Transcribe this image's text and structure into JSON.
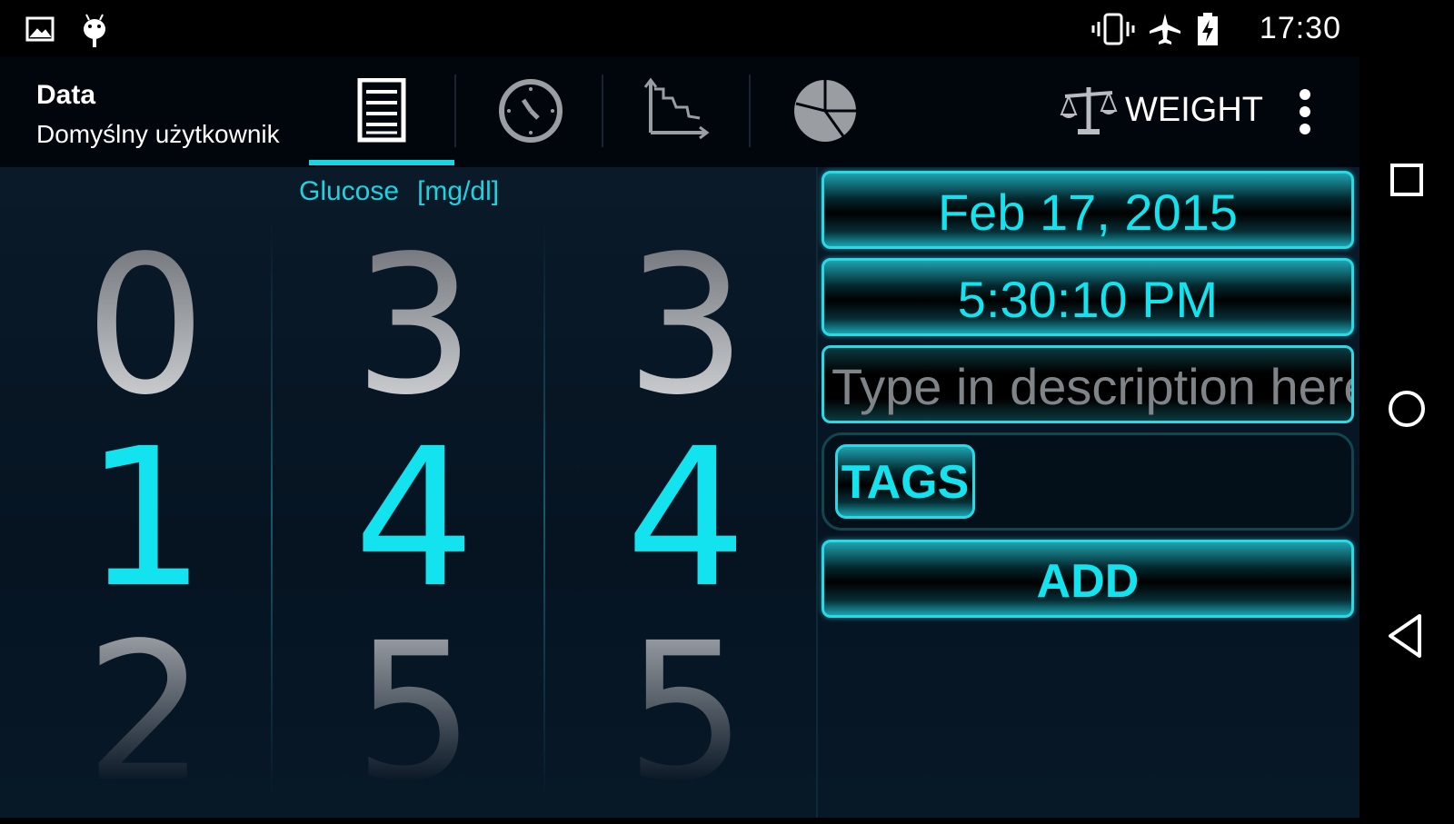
{
  "status_bar": {
    "time": "17:30",
    "icons": [
      "image-notification-icon",
      "android-debug-icon",
      "vibrate-icon",
      "airplane-mode-icon",
      "battery-charging-icon"
    ]
  },
  "action_bar": {
    "title": "Data",
    "subtitle": "Domyślny użytkownik",
    "tabs": [
      {
        "icon": "list-icon",
        "selected": true
      },
      {
        "icon": "clock-icon",
        "selected": false
      },
      {
        "icon": "trend-chart-icon",
        "selected": false
      },
      {
        "icon": "pie-chart-icon",
        "selected": false
      }
    ],
    "weight_label": "WEIGHT",
    "weight_icon": "scale-icon",
    "accent_color": "#17d7e4"
  },
  "picker": {
    "label": "Glucose",
    "unit": "[mg/dl]",
    "columns": [
      {
        "prev": "0",
        "current": "1",
        "next": "2"
      },
      {
        "prev": "3",
        "current": "4",
        "next": "5"
      },
      {
        "prev": "3",
        "current": "4",
        "next": "5"
      }
    ]
  },
  "form": {
    "date": "Feb 17, 2015",
    "time": "5:30:10 PM",
    "description_placeholder": "Type in description here",
    "tags_label": "TAGS",
    "add_label": "ADD"
  },
  "nav_bar": {
    "icons": [
      "recents-icon",
      "home-icon",
      "back-icon"
    ]
  }
}
